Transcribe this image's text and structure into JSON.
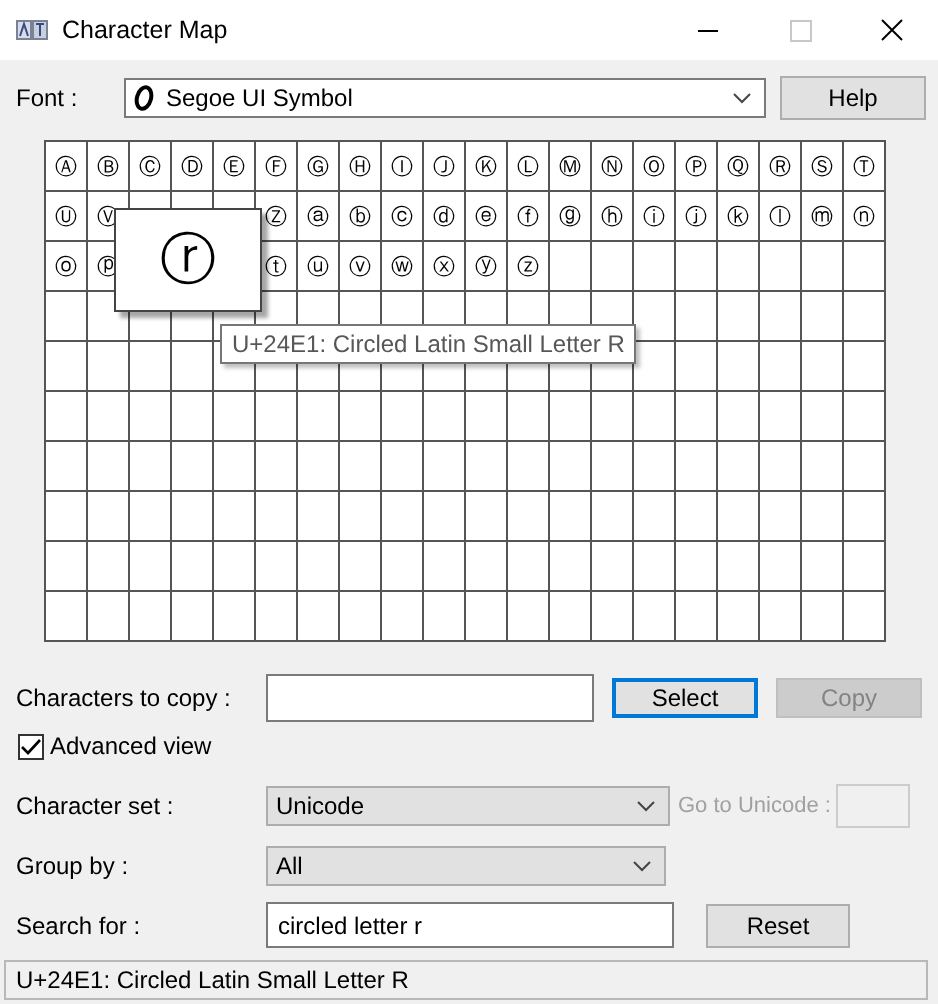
{
  "window": {
    "title": "Character Map",
    "maximize_disabled": true
  },
  "font": {
    "label": "Font :",
    "value": "Segoe UI Symbol"
  },
  "help_button": {
    "label": "Help"
  },
  "grid": {
    "rows": [
      {
        "cells": [
          "Ⓐ",
          "Ⓑ",
          "Ⓒ",
          "Ⓓ",
          "Ⓔ",
          "Ⓕ",
          "Ⓖ",
          "Ⓗ",
          "Ⓘ",
          "Ⓙ",
          "Ⓚ",
          "Ⓛ",
          "Ⓜ",
          "Ⓝ",
          "Ⓞ",
          "Ⓟ",
          "Ⓠ",
          "Ⓡ",
          "Ⓢ",
          "Ⓣ"
        ]
      },
      {
        "cells": [
          "Ⓤ",
          "Ⓥ"
        ],
        "cells_after_popup": [
          "Ⓩ",
          "ⓐ",
          "ⓑ",
          "ⓒ",
          "ⓓ",
          "ⓔ",
          "ⓕ",
          "ⓖ",
          "ⓗ",
          "ⓘ",
          "ⓙ",
          "ⓚ",
          "ⓛ",
          "ⓜ",
          "ⓝ"
        ]
      },
      {
        "cells": [
          "ⓞ",
          "ⓟ"
        ],
        "cells_after_popup": [
          "ⓣ",
          "ⓤ",
          "ⓥ",
          "ⓦ",
          "ⓧ",
          "ⓨ",
          "ⓩ"
        ]
      }
    ],
    "magnified": "ⓡ",
    "tooltip": "U+24E1: Circled Latin Small Letter R"
  },
  "copy": {
    "label": "Characters to copy :",
    "buttons": [
      {
        "label": "Select",
        "focused": true,
        "disabled": false
      },
      {
        "label": "Copy",
        "focused": false,
        "disabled": true
      }
    ]
  },
  "advanced_view": {
    "label": "Advanced view",
    "checked": true
  },
  "character_set": {
    "label": "Character set :",
    "value": "Unicode"
  },
  "go_to_unicode": {
    "label": "Go to Unicode :",
    "disabled": true
  },
  "group_by": {
    "label": "Group by :",
    "value": "All"
  },
  "search": {
    "label": "Search for :",
    "value": "circled letter r",
    "button": "Reset"
  },
  "status_bar": "U+24E1: Circled Latin Small Letter R"
}
